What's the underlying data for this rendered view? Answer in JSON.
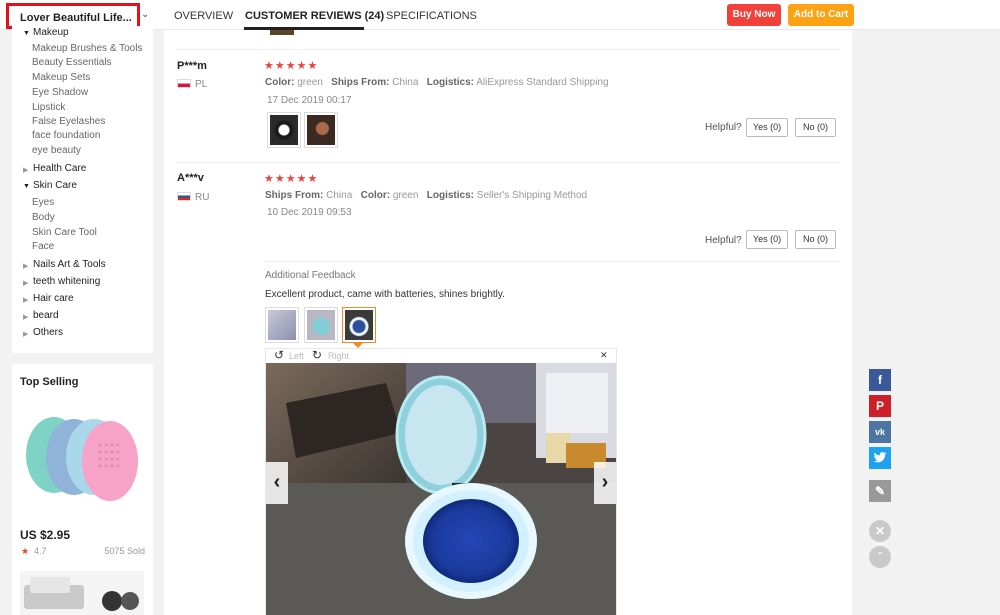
{
  "header": {
    "store_name": "Lover Beautiful Life...",
    "tabs": [
      "OVERVIEW",
      "CUSTOMER REVIEWS (24)",
      "SPECIFICATIONS"
    ],
    "buy_now": "Buy Now",
    "add_to_cart": "Add to Cart"
  },
  "categories": {
    "makeup": "Makeup",
    "makeup_sub": [
      "Makeup Brushes & Tools",
      "Beauty Essentials",
      "Makeup Sets",
      "Eye Shadow",
      "Lipstick",
      "False Eyelashes",
      "face foundation",
      "eye beauty"
    ],
    "health_care": "Health Care",
    "skin_care": "Skin Care",
    "skin_sub": [
      "Eyes",
      "Body",
      "Skin Care Tool",
      "Face"
    ],
    "others_list": [
      "Nails Art & Tools",
      "teeth whitening",
      "Hair care",
      "beard",
      "Others"
    ]
  },
  "top_selling": {
    "title": "Top Selling",
    "price": "US $2.95",
    "star": "★",
    "rating": "4.7",
    "sold": "5075 Sold"
  },
  "reviews": [
    {
      "name": "P***m",
      "country": "PL",
      "stars": "★★★★★",
      "attr1_label": "Color:",
      "attr1_value": "green",
      "attr2_label": "Ships From:",
      "attr2_value": "China",
      "attr3_label": "Logistics:",
      "attr3_value": "AliExpress Standard Shipping",
      "date": "17 Dec 2019 00:17",
      "helpful": "Helpful?",
      "yes": "Yes (0)",
      "no": "No (0)"
    },
    {
      "name": "A***v",
      "country": "RU",
      "stars": "★★★★★",
      "attr1_label": "Ships From:",
      "attr1_value": "China",
      "attr2_label": "Color:",
      "attr2_value": "green",
      "attr3_label": "Logistics:",
      "attr3_value": "Seller's Shipping Method",
      "date": "10 Dec 2019 09:53",
      "helpful": "Helpful?",
      "yes": "Yes (0)",
      "no": "No (0)",
      "additional_title": "Additional Feedback",
      "additional_text": "Excellent product, came with batteries, shines brightly."
    }
  ],
  "viewer": {
    "rotate_left": "Left",
    "rotate_right": "Right",
    "close": "✕",
    "prev": "‹",
    "next": "›"
  },
  "share": {
    "facebook_icon": "facebook-icon",
    "pinterest_icon": "pinterest-icon",
    "vk_icon": "vk-icon",
    "twitter_icon": "twitter-icon",
    "edit_icon": "pencil-icon",
    "colors": {
      "facebook": "#3b5998",
      "pinterest": "#cb2027",
      "vk": "#4c75a3",
      "twitter": "#1da1f2",
      "edit": "#999999"
    }
  },
  "colors": {
    "accent_red": "#e0131a",
    "buy_now": "#f2403a",
    "add_to_cart": "#fda213",
    "star": "#e8443b"
  }
}
